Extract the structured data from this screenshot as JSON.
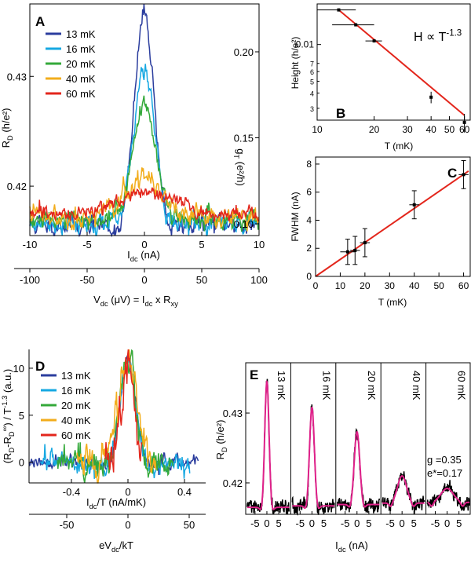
{
  "figure": {
    "panel_letters": [
      "A",
      "B",
      "C",
      "D",
      "E"
    ]
  },
  "colors": {
    "13 mK": "#2b3d9e",
    "16 mK": "#16a8e2",
    "20 mK": "#34a93a",
    "40 mK": "#f2ad1c",
    "60 mK": "#e3261c",
    "fit_line": "#e3261c",
    "fit_curve": "#e0218a",
    "data_black": "#000000"
  },
  "chart_data": [
    {
      "panel": "A",
      "type": "line",
      "xlabel": "I_dc (nA)",
      "ylabel": "R_D (h/e²)",
      "y2label": "g_T (e²/h)",
      "xlim": [
        -10,
        10
      ],
      "ylim": [
        0.4155,
        0.4366
      ],
      "xticks": [
        -10,
        -5,
        0,
        5,
        10
      ],
      "yticks": [
        0.42,
        0.43
      ],
      "y2ticks": [
        0.1,
        0.15,
        0.2
      ],
      "x2label": "V_dc (μV) = I_dc x R_xy",
      "x2ticks": [
        -100,
        -50,
        0,
        50,
        100
      ],
      "legend": [
        "13 mK",
        "16 mK",
        "20 mK",
        "40 mK",
        "60 mK"
      ],
      "legend_position": "top-left",
      "series": [
        {
          "name": "13 mK",
          "baseline": 0.4165,
          "peak": 0.4357,
          "width": 0.85,
          "dip": 0.0007,
          "noise": 0.00045
        },
        {
          "name": "16 mK",
          "baseline": 0.4167,
          "peak": 0.431,
          "width": 0.9,
          "dip": 0.0004,
          "noise": 0.00045
        },
        {
          "name": "20 mK",
          "baseline": 0.417,
          "peak": 0.4272,
          "width": 1.05,
          "dip": 0.0002,
          "noise": 0.00045
        },
        {
          "name": "40 mK",
          "baseline": 0.4172,
          "peak": 0.4208,
          "width": 1.6,
          "dip": 0.0,
          "noise": 0.00045
        },
        {
          "name": "60 mK",
          "baseline": 0.4174,
          "peak": 0.4194,
          "width": 2.6,
          "dip": 0.0,
          "noise": 0.0003
        }
      ]
    },
    {
      "panel": "B",
      "type": "scatter",
      "xlabel": "T (mK)",
      "ylabel": "Height (h/e²)",
      "scale": "log-log",
      "annotation": "H ∝ T^-1.3",
      "xticks": [
        10,
        20,
        30,
        40,
        50,
        60
      ],
      "ytick_labels": [
        "0.01",
        "7",
        "6",
        "5",
        "4",
        "3"
      ],
      "points": [
        {
          "x": 13,
          "y": 0.0192,
          "xerr": 3
        },
        {
          "x": 16,
          "y": 0.0145,
          "xerr": 4
        },
        {
          "x": 20,
          "y": 0.0107,
          "xerr": 2
        },
        {
          "x": 40,
          "y": 0.0037,
          "yerr": 0.0004
        },
        {
          "x": 60,
          "y": 0.0023,
          "yerr": 0.0004
        }
      ],
      "fit": {
        "exponent": -1.3,
        "x_range": [
          13,
          60
        ]
      }
    },
    {
      "panel": "C",
      "type": "scatter",
      "xlabel": "T (mK)",
      "ylabel": "FWHM (nA)",
      "xlim": [
        0,
        63
      ],
      "ylim": [
        0,
        8.5
      ],
      "xticks": [
        0,
        10,
        20,
        30,
        40,
        50,
        60
      ],
      "yticks": [
        0,
        2,
        4,
        6,
        8
      ],
      "points": [
        {
          "x": 13,
          "y": 1.75,
          "xerr": 3,
          "yerr": 0.9
        },
        {
          "x": 16,
          "y": 1.85,
          "xerr": 2,
          "yerr": 1.0
        },
        {
          "x": 20,
          "y": 2.4,
          "xerr": 2,
          "yerr": 1.0
        },
        {
          "x": 40,
          "y": 5.1,
          "xerr": 2,
          "yerr": 1.0
        },
        {
          "x": 60,
          "y": 7.25,
          "xerr": 2,
          "yerr": 1.0
        }
      ],
      "fit": {
        "slope": 0.121,
        "x_range": [
          0,
          62
        ]
      }
    },
    {
      "panel": "D",
      "type": "line",
      "xlabel": "I_dc/T (nA/mK)",
      "ylabel": "(R_D-R_D^∞) / T^-1.3 (a.u.)",
      "xlim": [
        -0.7,
        0.55
      ],
      "ylim": [
        -2.2,
        12
      ],
      "xticks": [
        -0.4,
        0,
        0.4
      ],
      "yticks": [
        0,
        5,
        10
      ],
      "x2label": "eV_dc/kT",
      "x2ticks": [
        -50,
        0,
        50
      ],
      "legend": [
        "13 mK",
        "16 mK",
        "20 mK",
        "40 mK",
        "60 mK"
      ],
      "legend_position": "top-left",
      "series": [
        {
          "name": "13 mK",
          "peak": 10.9,
          "width": 0.055
        },
        {
          "name": "16 mK",
          "peak": 10.7,
          "width": 0.055
        },
        {
          "name": "20 mK",
          "peak": 10.8,
          "width": 0.055
        },
        {
          "name": "40 mK",
          "peak": 11.0,
          "width": 0.06
        },
        {
          "name": "60 mK",
          "peak": 10.3,
          "width": 0.05
        }
      ]
    },
    {
      "panel": "E",
      "type": "line",
      "xlabel": "I_dc (nA)",
      "ylabel": "R_D (h/e²)",
      "ylim": [
        0.4155,
        0.4372
      ],
      "yticks": [
        0.42,
        0.43
      ],
      "xtick_labels": [
        "-5",
        "0",
        "5"
      ],
      "annotation_g": "g =0.35",
      "annotation_e": "e*=0.17",
      "temperatures": [
        "13 mK",
        "16 mK",
        "20 mK",
        "40 mK",
        "60 mK"
      ],
      "series": [
        {
          "name": "13 mK",
          "baseline": 0.4165,
          "peak": 0.4345,
          "width": 0.9
        },
        {
          "name": "16 mK",
          "baseline": 0.4167,
          "peak": 0.4308,
          "width": 1.0
        },
        {
          "name": "20 mK",
          "baseline": 0.4169,
          "peak": 0.4273,
          "width": 1.15
        },
        {
          "name": "40 mK",
          "baseline": 0.4171,
          "peak": 0.421,
          "width": 1.9
        },
        {
          "name": "60 mK",
          "baseline": 0.4172,
          "peak": 0.4192,
          "width": 2.6
        }
      ]
    }
  ]
}
